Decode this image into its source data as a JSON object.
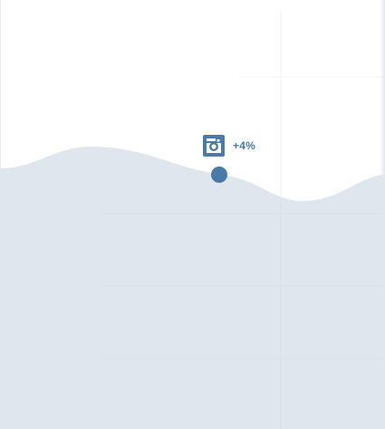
{
  "chart_data": {
    "type": "area",
    "title": "",
    "xlabel": "",
    "ylabel": "",
    "grid": true,
    "annotations": [
      {
        "icon": "instagram-icon",
        "text": "+4%"
      }
    ]
  },
  "colors": {
    "area_fill": "#dfe6ee",
    "marker": "#4a7aa7",
    "grid": "#eef1f4",
    "icon": "#4a7aa7"
  },
  "callout": {
    "icon": "instagram-icon",
    "label": "+4%"
  }
}
